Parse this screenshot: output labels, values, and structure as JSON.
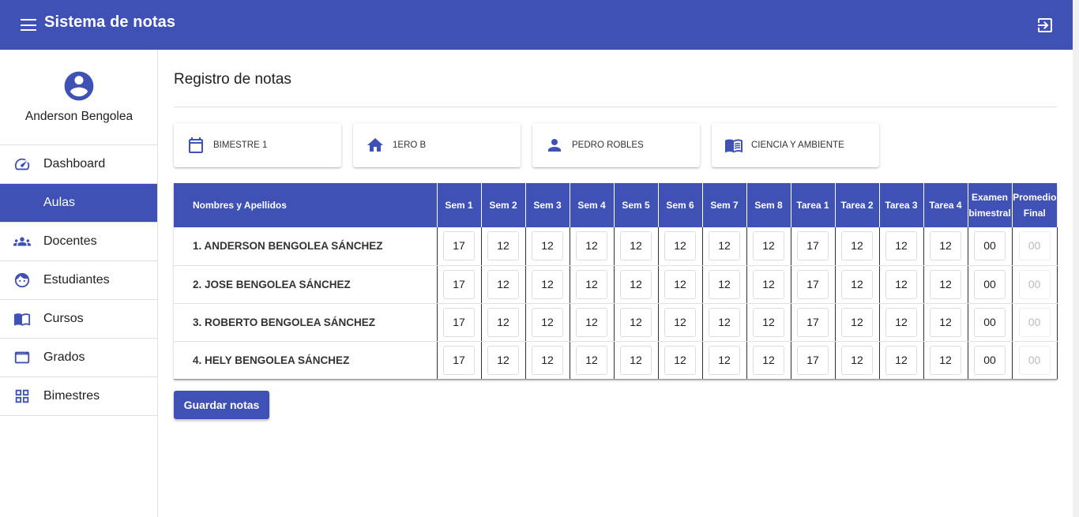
{
  "app": {
    "title": "Sistema de notas"
  },
  "user": {
    "name": "Anderson Bengolea"
  },
  "sidebar": {
    "items": [
      {
        "label": "Dashboard",
        "icon": "speedometer-icon",
        "active": false
      },
      {
        "label": "Aulas",
        "icon": "",
        "active": true
      },
      {
        "label": "Docentes",
        "icon": "people-icon",
        "active": false
      },
      {
        "label": "Estudiantes",
        "icon": "face-icon",
        "active": false
      },
      {
        "label": "Cursos",
        "icon": "book-icon",
        "active": false
      },
      {
        "label": "Grados",
        "icon": "frame-icon",
        "active": false
      },
      {
        "label": "Bimestres",
        "icon": "grid-icon",
        "active": false
      }
    ]
  },
  "page": {
    "title": "Registro de notas"
  },
  "filters": [
    {
      "label": "BIMESTRE 1",
      "icon": "calendar-icon"
    },
    {
      "label": "1ERO B",
      "icon": "home-icon"
    },
    {
      "label": "PEDRO ROBLES",
      "icon": "person-icon"
    },
    {
      "label": "CIENCIA Y AMBIENTE",
      "icon": "book-open-icon"
    }
  ],
  "table": {
    "headers": {
      "name": "Nombres y Apellidos",
      "sem1": "Sem 1",
      "sem2": "Sem 2",
      "sem3": "Sem 3",
      "sem4": "Sem 4",
      "sem5": "Sem 5",
      "sem6": "Sem 6",
      "sem7": "Sem 7",
      "sem8": "Sem 8",
      "tarea1": "Tarea 1",
      "tarea2": "Tarea 2",
      "tarea3": "Tarea 3",
      "tarea4": "Tarea 4",
      "examen_1": "Examen",
      "examen_2": "bimestral",
      "promedio_1": "Promedio",
      "promedio_2": "Final"
    },
    "rows": [
      {
        "index": "1.",
        "name": "ANDERSON BENGOLEA SÁNCHEZ",
        "grades": [
          "17",
          "12",
          "12",
          "12",
          "12",
          "12",
          "12",
          "12",
          "17",
          "12",
          "12",
          "12"
        ],
        "examen": "00",
        "promedio": "00"
      },
      {
        "index": "2.",
        "name": "JOSE BENGOLEA SÁNCHEZ",
        "grades": [
          "17",
          "12",
          "12",
          "12",
          "12",
          "12",
          "12",
          "12",
          "17",
          "12",
          "12",
          "12"
        ],
        "examen": "00",
        "promedio": "00"
      },
      {
        "index": "3.",
        "name": "ROBERTO BENGOLEA SÁNCHEZ",
        "grades": [
          "17",
          "12",
          "12",
          "12",
          "12",
          "12",
          "12",
          "12",
          "17",
          "12",
          "12",
          "12"
        ],
        "examen": "00",
        "promedio": "00"
      },
      {
        "index": "4.",
        "name": "HELY BENGOLEA SÁNCHEZ",
        "grades": [
          "17",
          "12",
          "12",
          "12",
          "12",
          "12",
          "12",
          "12",
          "17",
          "12",
          "12",
          "12"
        ],
        "examen": "00",
        "promedio": "00"
      }
    ]
  },
  "actions": {
    "save_label": "Guardar notas"
  },
  "colors": {
    "primary": "#3f51b5",
    "icon": "#3f51b5"
  }
}
